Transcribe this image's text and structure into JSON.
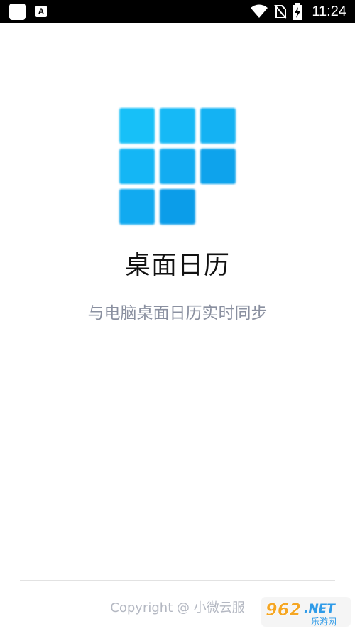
{
  "status_bar": {
    "time": "11:24",
    "notification_badge": "A",
    "icons": [
      "app-notification-icon",
      "font-notification-icon",
      "wifi-icon",
      "no-sim-icon",
      "battery-charging-icon"
    ]
  },
  "app": {
    "title": "桌面日历",
    "subtitle": "与电脑桌面日历实时同步",
    "accent_colors": [
      "#1fc6f9",
      "#0a9ae6"
    ]
  },
  "footer": {
    "copyright": "Copyright @ 小微云服"
  },
  "watermark": {
    "number": "962",
    "suffix": ".NET",
    "label": "乐游网"
  }
}
